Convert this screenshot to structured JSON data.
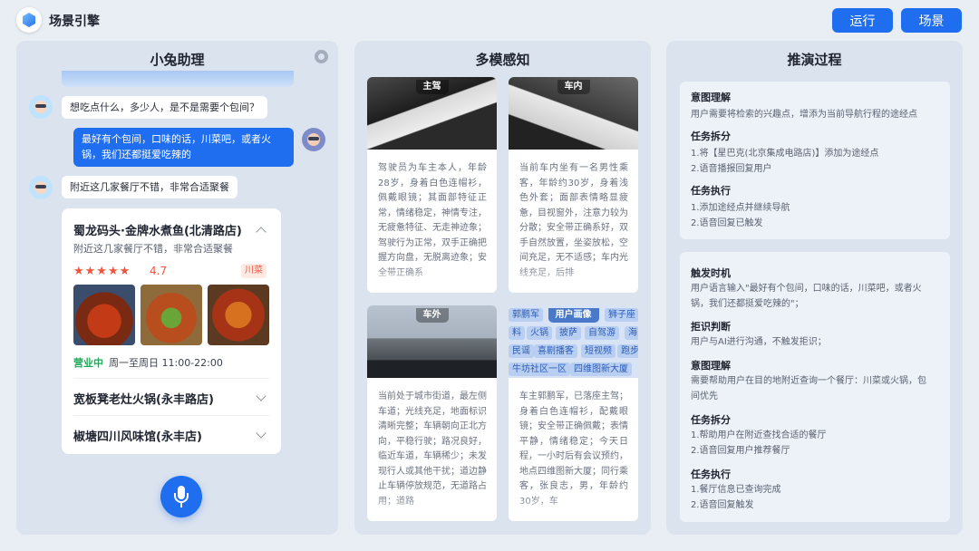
{
  "app": {
    "title": "场景引擎"
  },
  "toolbar": {
    "run_label": "运行",
    "scene_label": "场景"
  },
  "assistant": {
    "title": "小兔助理",
    "messages": [
      {
        "role": "ai",
        "text": "想吃点什么，多少人，是不是需要个包间？"
      },
      {
        "role": "user",
        "text_line1": "最好有个包间，口味的话，川菜吧，或者火",
        "text_line2": "锅，我们还都挺爱吃辣的"
      },
      {
        "role": "ai",
        "text": "附近这几家餐厅不错，非常合适聚餐"
      }
    ],
    "card": {
      "name": "蜀龙码头·金牌水煮鱼(北清路店)",
      "desc": "附近这几家餐厅不错，非常合适聚餐",
      "stars": "★★★★★",
      "rating": "4.7",
      "tag": "川菜",
      "status": "营业中",
      "hours": "周一至周日 11:00-22:00",
      "others": [
        "宽板凳老灶火锅(永丰路店)",
        "椒塘四川风味馆(永丰店)"
      ]
    }
  },
  "perception": {
    "title": "多模感知",
    "cards": [
      {
        "label": "主驾",
        "text": "驾驶员为车主本人，年龄28岁，身着白色连帽衫，佩戴眼镜；其面部特征正常，情绪稳定，神情专注，无疲惫特征、无走神迹象；驾驶行为正常，双手正确把握方向盘，无脱离迹象；安全带正确系"
      },
      {
        "label": "车内",
        "text": "当前车内坐有一名男性乘客，年龄约30岁，身着浅色外套；面部表情略显疲惫，目视窗外，注意力较为分散；安全带正确系好，双手自然放置，坐姿放松，空间充足，无不适感；车内光线充足，后排"
      },
      {
        "label": "车外",
        "text": "当前处于城市街道，最左侧车道；光线充足，地面标识清晰完整；车辆朝向正北方向，平稳行驶；路况良好，临近车道，车辆稀少；未发现行人或其他干扰；道边静止车辆停放规范，无道路占用；道路"
      },
      {
        "label": "用户画像",
        "text": "车主郭鹏军，已落座主驾；身着白色连帽衫，配戴眼镜；安全带正确佩戴；表情平静，情绪稳定；今天日程，一小时后有会议预约，地点四维图新大厦；同行乘客，张良志，男，年龄约30岁，车",
        "chips": [
          "郭鹏军",
          "狮子座",
          "料",
          "火锅",
          "披萨",
          "自驾游",
          "海",
          "民谣",
          "喜剧播客",
          "短视频",
          "跑步",
          "牛坊社区一区",
          "四维图新大厦"
        ]
      }
    ]
  },
  "reasoning": {
    "title": "推演过程",
    "block1": [
      {
        "heading": "意图理解",
        "lines": [
          "用户需要将检索的兴趣点，增添为当前导航行程的途经点"
        ]
      },
      {
        "heading": "任务拆分",
        "lines": [
          "1.将【星巴克(北京集成电路店)】添加为途经点",
          "2.语音播报回复用户"
        ]
      },
      {
        "heading": "任务执行",
        "lines": [
          "1.添加途经点并继续导航",
          "2.语音回复已触发"
        ]
      }
    ],
    "block2": [
      {
        "heading": "触发时机",
        "lines": [
          "用户语言输入\"最好有个包间，口味的话，川菜吧，或者火",
          "锅，我们还都挺爱吃辣的\"；"
        ]
      },
      {
        "heading": "拒识判断",
        "lines": [
          "用户与AI进行沟通，不触发拒识；"
        ]
      },
      {
        "heading": "意图理解",
        "lines": [
          "需要帮助用户在目的地附近查询一个餐厅：川菜或火锅，包",
          "间优先"
        ]
      },
      {
        "heading": "任务拆分",
        "lines": [
          "1.帮助用户在附近查找合适的餐厅",
          "2.语音回复用户推荐餐厅"
        ]
      },
      {
        "heading": "任务执行",
        "lines": [
          "1.餐厅信息已查询完成",
          "2.语音回复触发"
        ]
      }
    ]
  }
}
